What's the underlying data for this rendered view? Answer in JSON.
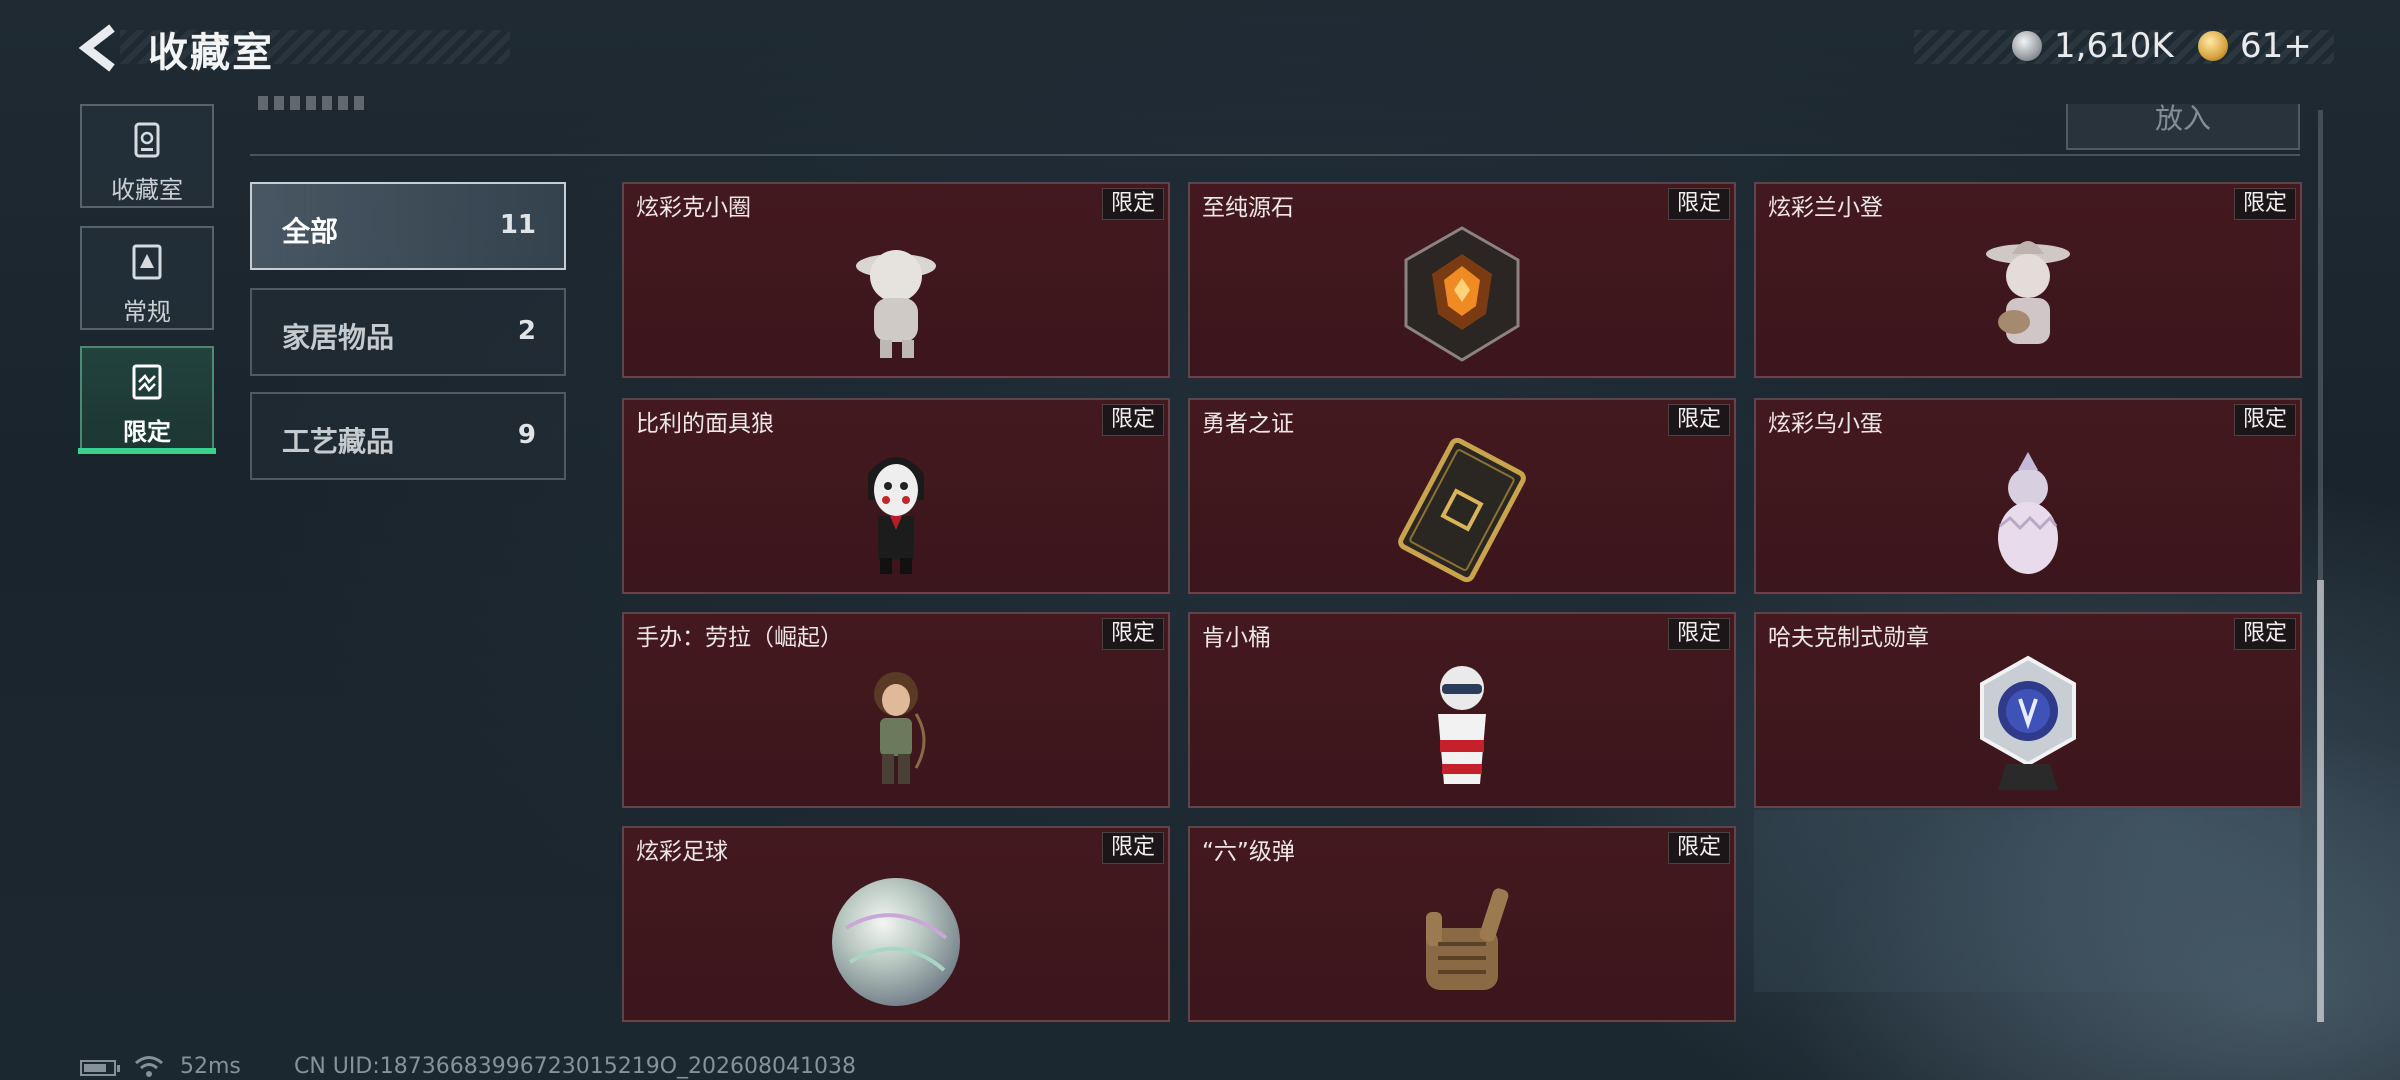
{
  "header": {
    "title": "收藏室",
    "currency": [
      {
        "icon": "silver-coin-icon",
        "value": "1,610K"
      },
      {
        "icon": "gold-coin-icon",
        "value": "61+"
      }
    ]
  },
  "nav": {
    "items": [
      {
        "label": "收藏室",
        "icon": "collection-room-icon"
      },
      {
        "label": "常规",
        "icon": "regular-card-icon"
      },
      {
        "label": "限定",
        "icon": "limited-card-icon",
        "active": true
      }
    ]
  },
  "toolbar": {
    "put_in_label": "放入"
  },
  "categories": [
    {
      "label": "全部",
      "count": "11",
      "active": true
    },
    {
      "label": "家居物品",
      "count": "2"
    },
    {
      "label": "工艺藏品",
      "count": "9"
    }
  ],
  "items": [
    {
      "name": "炫彩克小圈",
      "badge": "限定",
      "icon": "figurine-icon"
    },
    {
      "name": "至纯源石",
      "badge": "限定",
      "icon": "ore-crystal-icon"
    },
    {
      "name": "炫彩兰小登",
      "badge": "限定",
      "icon": "sombrero-figurine-icon"
    },
    {
      "name": "比利的面具狼",
      "badge": "限定",
      "icon": "masked-puppet-icon"
    },
    {
      "name": "勇者之证",
      "badge": "限定",
      "icon": "gold-card-icon"
    },
    {
      "name": "炫彩乌小蛋",
      "badge": "限定",
      "icon": "egg-figurine-icon"
    },
    {
      "name": "手办：劳拉（崛起）",
      "badge": "限定",
      "icon": "lara-figure-icon"
    },
    {
      "name": "肯小桶",
      "badge": "限定",
      "icon": "bucket-figure-icon"
    },
    {
      "name": "哈夫克制式勋章",
      "badge": "限定",
      "icon": "medal-icon"
    },
    {
      "name": "炫彩足球",
      "badge": "限定",
      "icon": "iridescent-ball-icon"
    },
    {
      "name": "“六”级弹",
      "badge": "限定",
      "icon": "hand-sign-icon"
    }
  ],
  "status": {
    "ping": "52ms",
    "uid": "CN UID:18736683996723015219O_202608041038"
  },
  "colors": {
    "accent": "#38d28f",
    "card_bg": "#3f1820"
  }
}
